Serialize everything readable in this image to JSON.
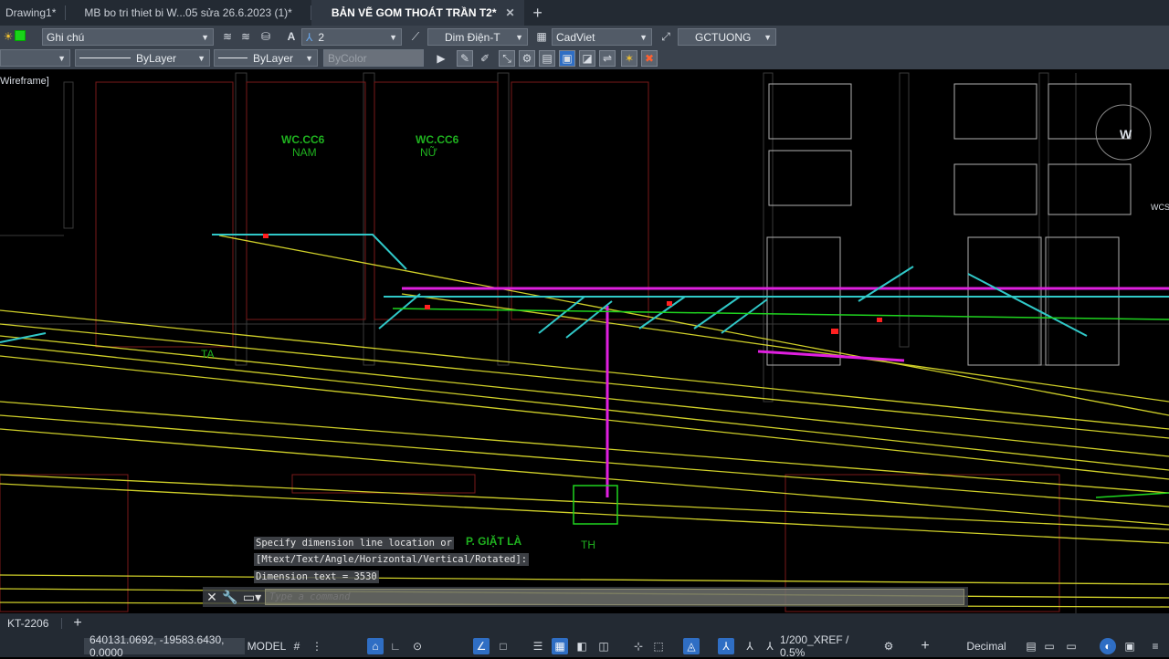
{
  "tabs": [
    {
      "label": "Drawing1*",
      "active": false
    },
    {
      "label": "MB bo tri thiet bi W...05 sửa 26.6.2023 (1)*",
      "active": false
    },
    {
      "label": "BẢN VẼ GOM THOÁT TRẦN T2*",
      "active": true
    }
  ],
  "toolbar1": {
    "layer_name": "Ghi chú",
    "layer_color": "#19d419",
    "text_height": "2",
    "dim_style": "Dim Điện-T",
    "text_style": "CadViet",
    "mleader_style": "GCTUONG"
  },
  "toolbar2": {
    "linetype": "ByLayer",
    "lineweight": "ByLayer",
    "plotstyle": "ByColor"
  },
  "viewport": {
    "visual_style": "Wireframe]",
    "viewcube_letter": "W",
    "wcs_label": "WCS"
  },
  "drawing_labels": {
    "room1_line1": "WC.CC6",
    "room1_line2": "NAM",
    "room2_line1": "WC.CC6",
    "room2_line2": "NỮ",
    "ta_label": "TA",
    "laundry": "P. GIẶT LÀ",
    "th_label": "TH"
  },
  "command": {
    "history": [
      "Specify dimension line location or",
      "[Mtext/Text/Angle/Horizontal/Vertical/Rotated]:",
      "Dimension text = 3530"
    ],
    "placeholder": "Type a command"
  },
  "layout_tab": "KT-2206",
  "status": {
    "coordinates": "640131.0692, -19583.6430, 0.0000",
    "space": "MODEL",
    "scale": "1/200_XREF / 0.5%",
    "units": "Decimal"
  },
  "colors": {
    "accent": "#2f6ec4",
    "yellow_lines": "#e6e62e",
    "magenta": "#e020e0",
    "cyan": "#30c8c8",
    "green_text": "#1fb21f"
  }
}
